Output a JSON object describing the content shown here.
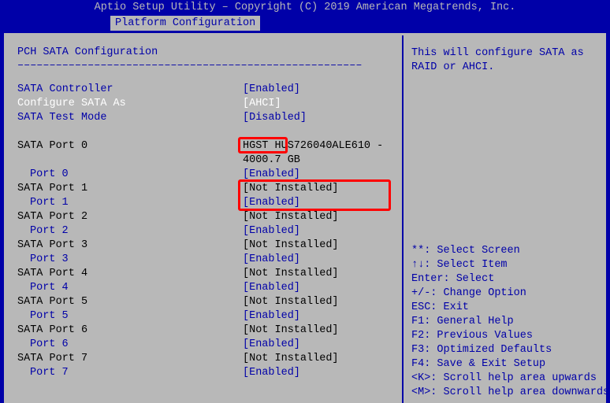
{
  "title": "Aptio Setup Utility – Copyright (C) 2019 American Megatrends, Inc.",
  "tab": "Platform Configuration",
  "section_title": "PCH SATA Configuration",
  "dashes": "––––––––––––––––––––––––––––––––––––––––––––––––––––––",
  "items": {
    "sata_controller": {
      "label": "SATA Controller",
      "value": "[Enabled]"
    },
    "configure_as": {
      "label": "Configure SATA As",
      "value": "[AHCI]"
    },
    "test_mode": {
      "label": "SATA Test Mode",
      "value": "[Disabled]"
    },
    "port0": {
      "label": "SATA Port 0",
      "value1": "HGST HUS726040ALE610 -",
      "value2": "4000.7 GB"
    },
    "p0": {
      "label": "Port 0",
      "value": "[Enabled]"
    },
    "port1": {
      "label": "SATA Port 1",
      "value": "[Not Installed]"
    },
    "p1": {
      "label": "Port 1",
      "value": "[Enabled]"
    },
    "port2": {
      "label": "SATA Port 2",
      "value": "[Not Installed]"
    },
    "p2": {
      "label": "Port 2",
      "value": "[Enabled]"
    },
    "port3": {
      "label": "SATA Port 3",
      "value": "[Not Installed]"
    },
    "p3": {
      "label": "Port 3",
      "value": "[Enabled]"
    },
    "port4": {
      "label": "SATA Port 4",
      "value": "[Not Installed]"
    },
    "p4": {
      "label": "Port 4",
      "value": "[Enabled]"
    },
    "port5": {
      "label": "SATA Port 5",
      "value": "[Not Installed]"
    },
    "p5": {
      "label": "Port 5",
      "value": "[Enabled]"
    },
    "port6": {
      "label": "SATA Port 6",
      "value": "[Not Installed]"
    },
    "p6": {
      "label": "Port 6",
      "value": "[Enabled]"
    },
    "port7": {
      "label": "SATA Port 7",
      "value": "[Not Installed]"
    },
    "p7": {
      "label": "Port 7",
      "value": "[Enabled]"
    }
  },
  "help": {
    "l1": "This will configure SATA as",
    "l2": "RAID or AHCI."
  },
  "hints": {
    "h1": "**: Select Screen",
    "h2": "↑↓: Select Item",
    "h3": "Enter: Select",
    "h4": "+/-: Change Option",
    "h5": "ESC: Exit",
    "h6": "F1: General Help",
    "h7": "F2: Previous Values",
    "h8": "F3: Optimized Defaults",
    "h9": "F4: Save & Exit Setup",
    "h10": "<K>: Scroll help area upwards",
    "h11": "<M>: Scroll help area downwards"
  }
}
